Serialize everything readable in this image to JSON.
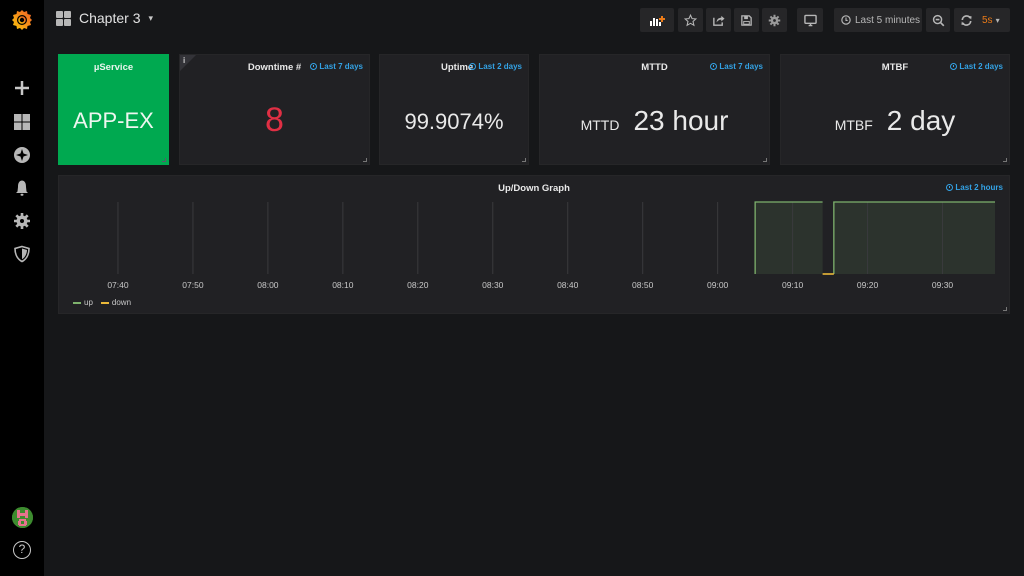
{
  "sidebar": {
    "logo": "grafana-logo",
    "items": [
      {
        "name": "create",
        "icon": "plus-icon"
      },
      {
        "name": "dashboards",
        "icon": "dashboards-grid-icon"
      },
      {
        "name": "explore",
        "icon": "compass-icon"
      },
      {
        "name": "alerting",
        "icon": "bell-icon"
      },
      {
        "name": "configuration",
        "icon": "gear-icon"
      },
      {
        "name": "server-admin",
        "icon": "shield-icon"
      }
    ],
    "help_label": "?"
  },
  "navbar": {
    "title": "Chapter 3",
    "caret": "▾",
    "buttons": [
      "add-panel",
      "star",
      "share",
      "save",
      "settings",
      "cycle-view-mode"
    ],
    "time_range": "Last 5 minutes",
    "refresh_interval": "5s",
    "refresh_caret": "▾"
  },
  "colors": {
    "accent_blue": "#33a2e5",
    "ok_green": "#00a950",
    "downtime_red": "#e02f44",
    "refresh_orange": "#eb7b18",
    "up_series": "#7eb26d",
    "down_series": "#eab839"
  },
  "panels": {
    "service": {
      "title": "µService",
      "value": "APP-EX"
    },
    "downtime": {
      "title": "Downtime #",
      "time": "Last 7 days",
      "value": "8",
      "info": "i"
    },
    "uptime": {
      "title": "Uptime",
      "time": "Last 2 days",
      "value": "99.9074%"
    },
    "mttd": {
      "title": "MTTD",
      "time": "Last 7 days",
      "prefix": "MTTD",
      "value": "23 hour"
    },
    "mtbf": {
      "title": "MTBF",
      "time": "Last 2 days",
      "prefix": "MTBF",
      "value": "2 day"
    },
    "graph": {
      "title": "Up/Down Graph",
      "time": "Last 2 hours"
    }
  },
  "chart_data": {
    "type": "line",
    "title": "Up/Down Graph",
    "xlabel": "",
    "ylabel": "",
    "x_ticks": [
      "07:40",
      "07:50",
      "08:00",
      "08:10",
      "08:20",
      "08:30",
      "08:40",
      "08:50",
      "09:00",
      "09:10",
      "09:20",
      "09:30"
    ],
    "x_range": [
      "07:34",
      "09:37"
    ],
    "y_range": [
      0,
      1
    ],
    "grid": true,
    "legend_position": "bottom-left",
    "series": [
      {
        "name": "up",
        "color": "#7eb26d",
        "fill": true,
        "segments": [
          {
            "from": "09:05",
            "to": "09:14",
            "value": 1
          },
          {
            "from": "09:15.5",
            "to": "09:37",
            "value": 1
          }
        ]
      },
      {
        "name": "down",
        "color": "#eab839",
        "fill": false,
        "segments": [
          {
            "from": "09:14",
            "to": "09:15.5",
            "value": 0
          }
        ]
      }
    ]
  }
}
